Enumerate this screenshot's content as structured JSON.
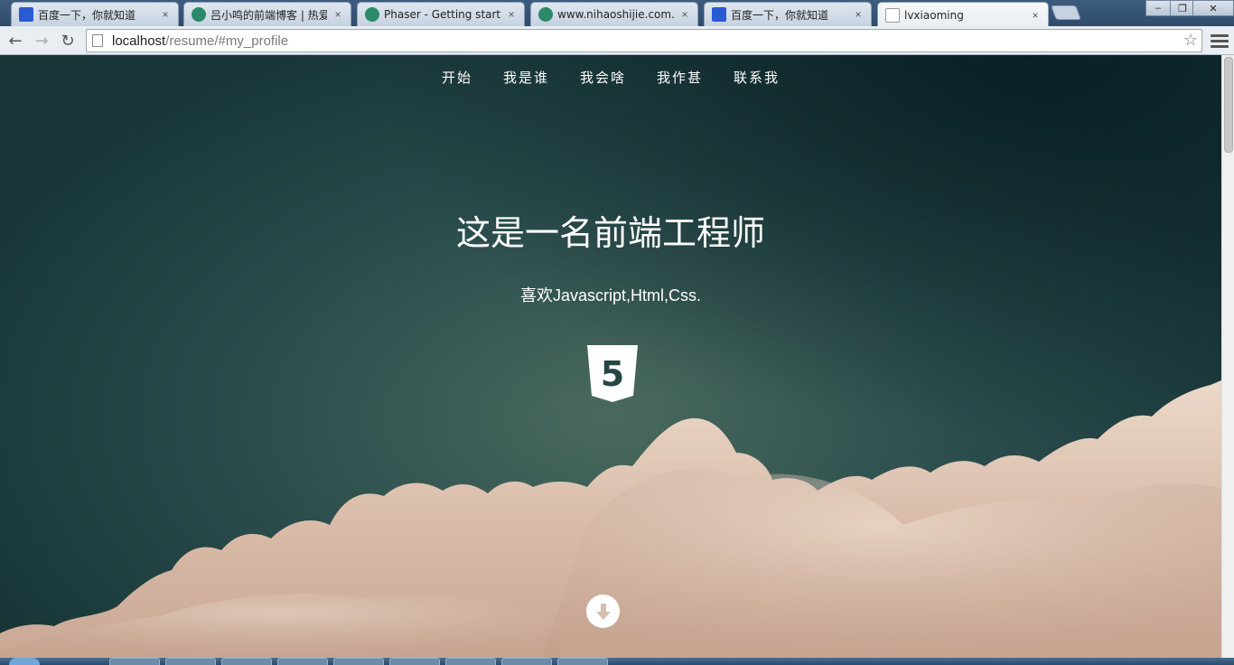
{
  "browser": {
    "tabs": [
      {
        "title": "百度一下，你就知道",
        "favicon": "baidu-paw-icon"
      },
      {
        "title": "吕小鸣的前端博客 | 热爱编",
        "favicon": "avatar-icon"
      },
      {
        "title": "Phaser - Getting started",
        "favicon": "avatar-icon"
      },
      {
        "title": "www.nihaoshijie.com.cn/",
        "favicon": "avatar-icon"
      },
      {
        "title": "百度一下，你就知道",
        "favicon": "baidu-paw-icon"
      },
      {
        "title": "lvxiaoming",
        "favicon": "document-icon",
        "active": true
      }
    ],
    "window_controls": {
      "minimize": "–",
      "maximize": "❐",
      "close": "✕"
    },
    "tab_close": "×",
    "address_bar": {
      "host": "localhost",
      "path": "/resume/#my_profile"
    }
  },
  "page": {
    "nav": [
      "开始",
      "我是谁",
      "我会啥",
      "我作甚",
      "联系我"
    ],
    "hero_title": "这是一名前端工程师",
    "hero_subtitle": "喜欢Javascript,Html,Css.",
    "html5_badge": "5"
  },
  "colors": {
    "sky_dark": "#183638",
    "sky_mid": "#2c4e4d",
    "cloud": "#e8d2c2",
    "text": "#ffffff"
  }
}
